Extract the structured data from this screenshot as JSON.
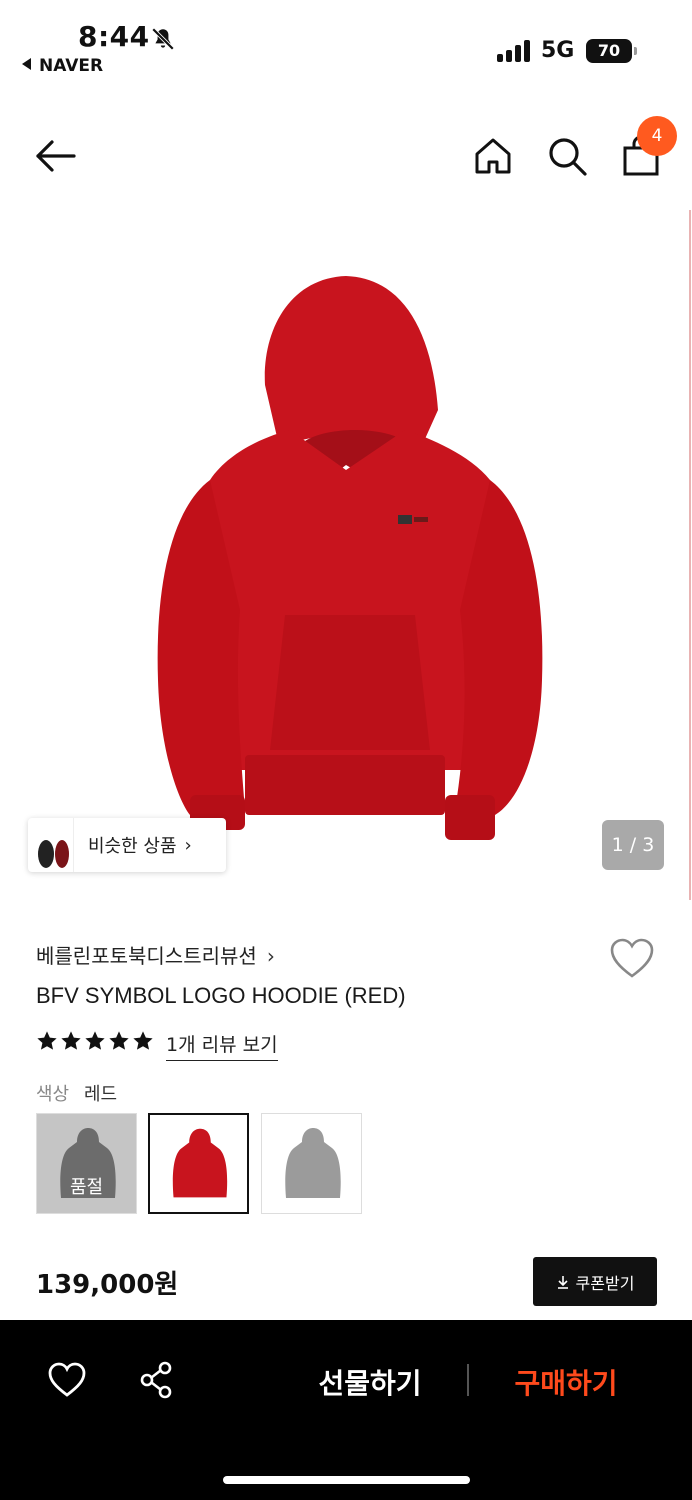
{
  "status_bar": {
    "time": "8:44",
    "back_app": "NAVER",
    "network": "5G",
    "battery": "70"
  },
  "header": {
    "cart_count": "4"
  },
  "gallery": {
    "similar_label": "비슷한 상품",
    "counter": "1 / 3",
    "main_color": "#c8141e"
  },
  "product": {
    "brand": "베를린포토북디스트리뷰션",
    "title": "BFV SYMBOL LOGO HOODIE (RED)",
    "rating_stars": 5,
    "review_link": "1개 리뷰 보기",
    "color_label": "색상",
    "color_value": "레드",
    "swatches": [
      {
        "color": "#3a3a3a",
        "sold_out": true,
        "sold_out_label": "품절"
      },
      {
        "color": "#c8141e",
        "selected": true
      },
      {
        "color": "#9b9b9b"
      }
    ],
    "price": "139,000원",
    "coupon_label": "쿠폰받기"
  },
  "bottom_bar": {
    "gift_label": "선물하기",
    "buy_label": "구매하기",
    "accent_color": "#ff4a1c"
  }
}
